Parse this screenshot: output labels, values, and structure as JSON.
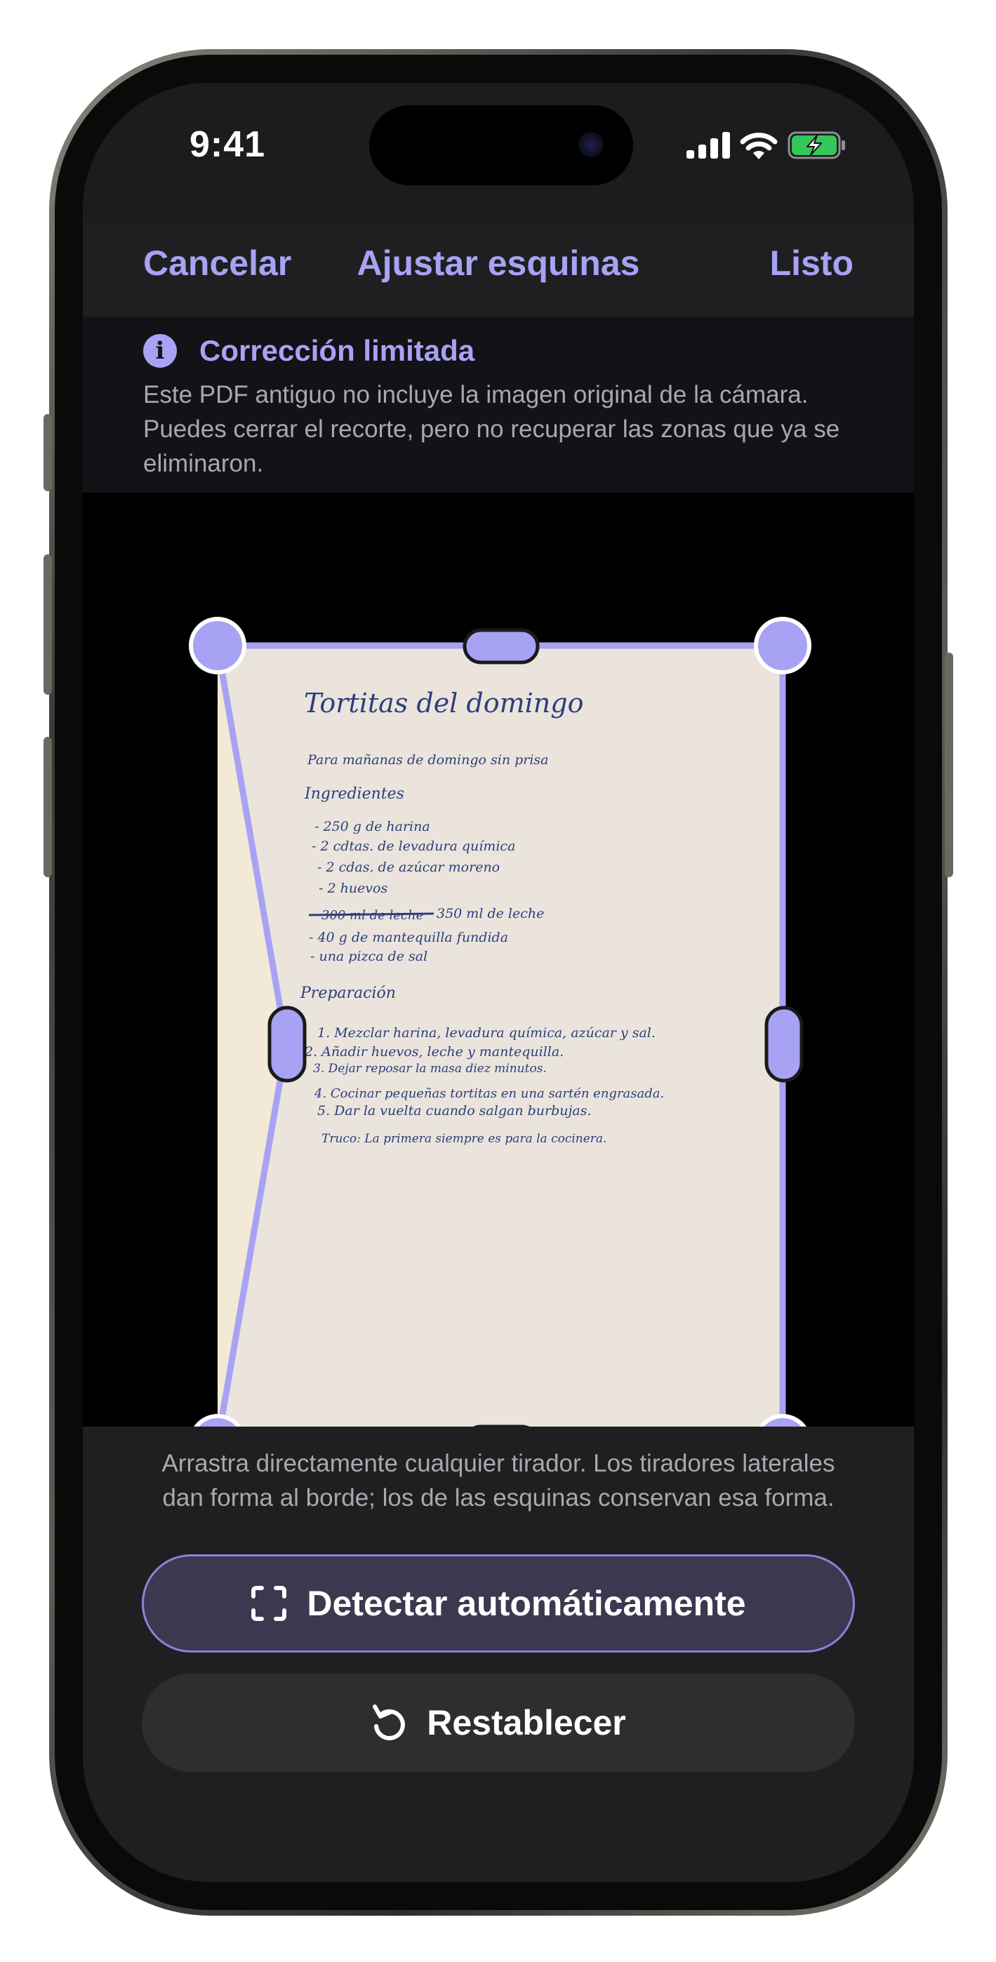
{
  "status_bar": {
    "time": "9:41"
  },
  "nav": {
    "cancel": "Cancelar",
    "title": "Ajustar esquinas",
    "done": "Listo"
  },
  "banner": {
    "icon": "info-icon",
    "title": "Corrección limitada",
    "text": "Este PDF antiguo no incluye la imagen original de la cámara. Puedes cerrar el recorte, pero no recuperar las zonas que ya se eliminaron."
  },
  "document": {
    "title": "Tortitas del domingo",
    "subtitle": "Para mañanas de domingo sin prisa",
    "ingredients_heading": "Ingredientes",
    "ingredients": [
      "- 250 g de harina",
      "- 2 cdtas. de levadura química",
      "- 2 cdas. de azúcar moreno",
      "- 2 huevos"
    ],
    "struck_item": "300 ml de leche",
    "replacement_item": "350 ml de leche",
    "ingredients_after": [
      "- 40 g de mantequilla fundida",
      "- una pizca de sal"
    ],
    "preparation_heading": "Preparación",
    "steps": [
      "1. Mezclar harina, levadura química, azúcar y sal.",
      "2. Añadir huevos, leche y mantequilla.",
      "3. Dejar reposar la masa diez minutos.",
      "4. Cocinar pequeñas tortitas en una sartén engrasada.",
      "5. Dar la vuelta cuando salgan burbujas."
    ],
    "tip": "Truco: La primera siempre es para la cocinera."
  },
  "hint": "Arrastra directamente cualquier tirador. Los tiradores laterales dan forma al borde; los de las esquinas conservan esa forma.",
  "buttons": {
    "detect": "Detectar automáticamente",
    "detect_icon": "scan-frame-icon",
    "reset": "Restablecer",
    "reset_icon": "rotate-ccw-icon"
  },
  "colors": {
    "accent": "#a8a2f4",
    "paper": "#eae4dd",
    "ink": "#2c3f7a"
  }
}
